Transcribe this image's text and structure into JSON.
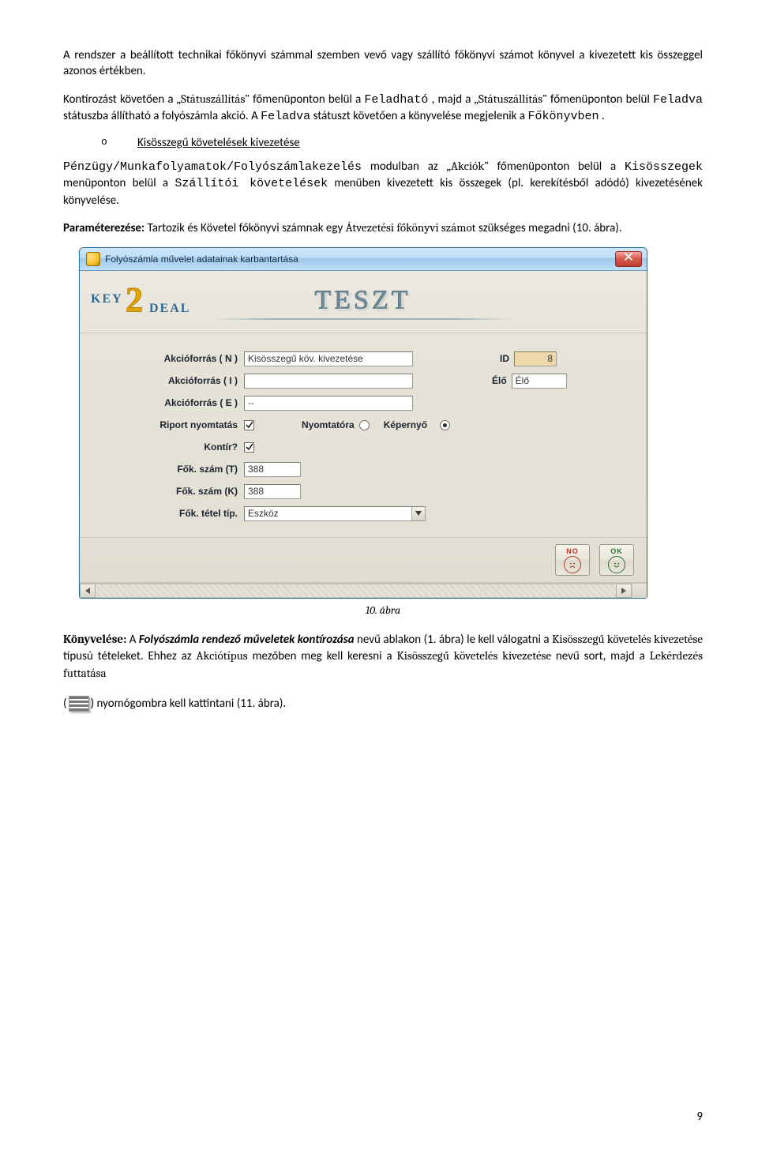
{
  "para1_a": "A rendszer a beállított technikai főkönyvi számmal szemben vevő vagy szállító főkönyvi számot könyvel a kivezetett kis összeggel azonos értékben.",
  "para2_lead": "Kontírozást követően a ",
  "para2_s1": "„Státuszállítás”",
  "para2_t1": " főmenüponton belül a ",
  "para2_m1": "Feladható",
  "para2_t2": ", majd a ",
  "para2_s2": "„Státuszállítás”",
  "para2_t3": " főmenüponton belül ",
  "para2_m2": "Feladva",
  "para2_t4": " státuszba állítható a folyószámla akció. A ",
  "para2_m3": "Feladva",
  "para2_t5": " státuszt követően a könyvelése megjelenik a ",
  "para2_m4": "Főkönyvben",
  "para2_end": ".",
  "bullet_o": "o",
  "bullet_label": "Kisösszegű követelések kivezetése",
  "para3_m1": "Pénzügy/Munkafolyamatok/Folyószámlakezelés",
  "para3_t1": " modulban az ",
  "para3_s1": "„Akciók”",
  "para3_t2": " főmenüponton belül a ",
  "para3_m2": "Kisösszegek",
  "para3_t3": " menüponton belül a ",
  "para3_m3": "Szállítói követelések",
  "para3_t4": " menüben kivezetett kis összegek (pl. kerekítésből adódó) kivezetésének könyvelése.",
  "para4_b1": "Paraméterezése:",
  "para4_t1": " Tartozik és Követel főkönyvi számnak egy ",
  "para4_s1": "Átvezetési főkönyvi számot",
  "para4_t2": " szükséges megadni (10. ábra).",
  "dialog": {
    "title": "Folyószámla művelet adatainak karbantartása",
    "close": "×",
    "banner": "TESZT",
    "labels": {
      "akc_n": "Akcióforrás ( N )",
      "akc_i": "Akcióforrás ( I )",
      "akc_e": "Akcióforrás ( E )",
      "riport": "Riport nyomtatás",
      "nyomtato": "Nyomtatóra",
      "kepernyo": "Képernyő",
      "kontir": "Kontír?",
      "fok_t": "Fők. szám (T)",
      "fok_k": "Fők. szám (K)",
      "fok_tetel": "Fők. tétel típ.",
      "id": "ID",
      "elo": "Élő"
    },
    "values": {
      "akc_n": "Kisösszegű köv. kivezetése",
      "akc_i": "",
      "akc_e": "--",
      "id": "8",
      "elo": "Élő",
      "fok_t": "388",
      "fok_k": "388",
      "fok_tetel": "Eszköz"
    },
    "buttons": {
      "no": "NO",
      "ok": "OK"
    }
  },
  "caption": "10. ábra",
  "para5_s1": "Könyvelése:",
  "para5_t1": " A ",
  "para5_b1": "Folyószámla rendező műveletek kontírozása",
  "para5_t2": " nevű ablakon (1. ábra) le kell válogatni a ",
  "para5_s2": "Kisösszegű követelés kivezetése",
  "para5_t3": " típusú tételeket. Ehhez az ",
  "para5_s3": "Akciótípus",
  "para5_t4": " mezőben meg kell keresni a ",
  "para5_s4": "Kisösszegű követelés kivezetése",
  "para5_t5": " nevű sort, majd a ",
  "para5_s5": "Lekérdezés futtatása",
  "para6_a": "(",
  "para6_b": ") nyomógombra kell kattintani (11. ábra).",
  "page_number": "9"
}
